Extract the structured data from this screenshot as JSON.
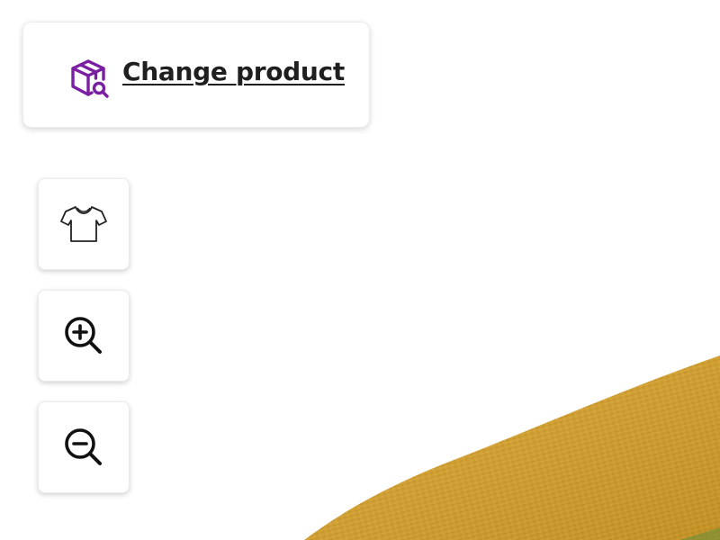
{
  "header": {
    "change_product_label": "Change product",
    "change_product_icon": "package-search-icon",
    "accent_color": "#7b1fa2"
  },
  "toolbar": {
    "buttons": [
      {
        "name": "product-view-button",
        "icon": "tshirt-icon"
      },
      {
        "name": "zoom-in-button",
        "icon": "zoom-in-icon"
      },
      {
        "name": "zoom-out-button",
        "icon": "zoom-out-icon"
      }
    ]
  },
  "canvas": {
    "product_color": "#d8a22a"
  }
}
